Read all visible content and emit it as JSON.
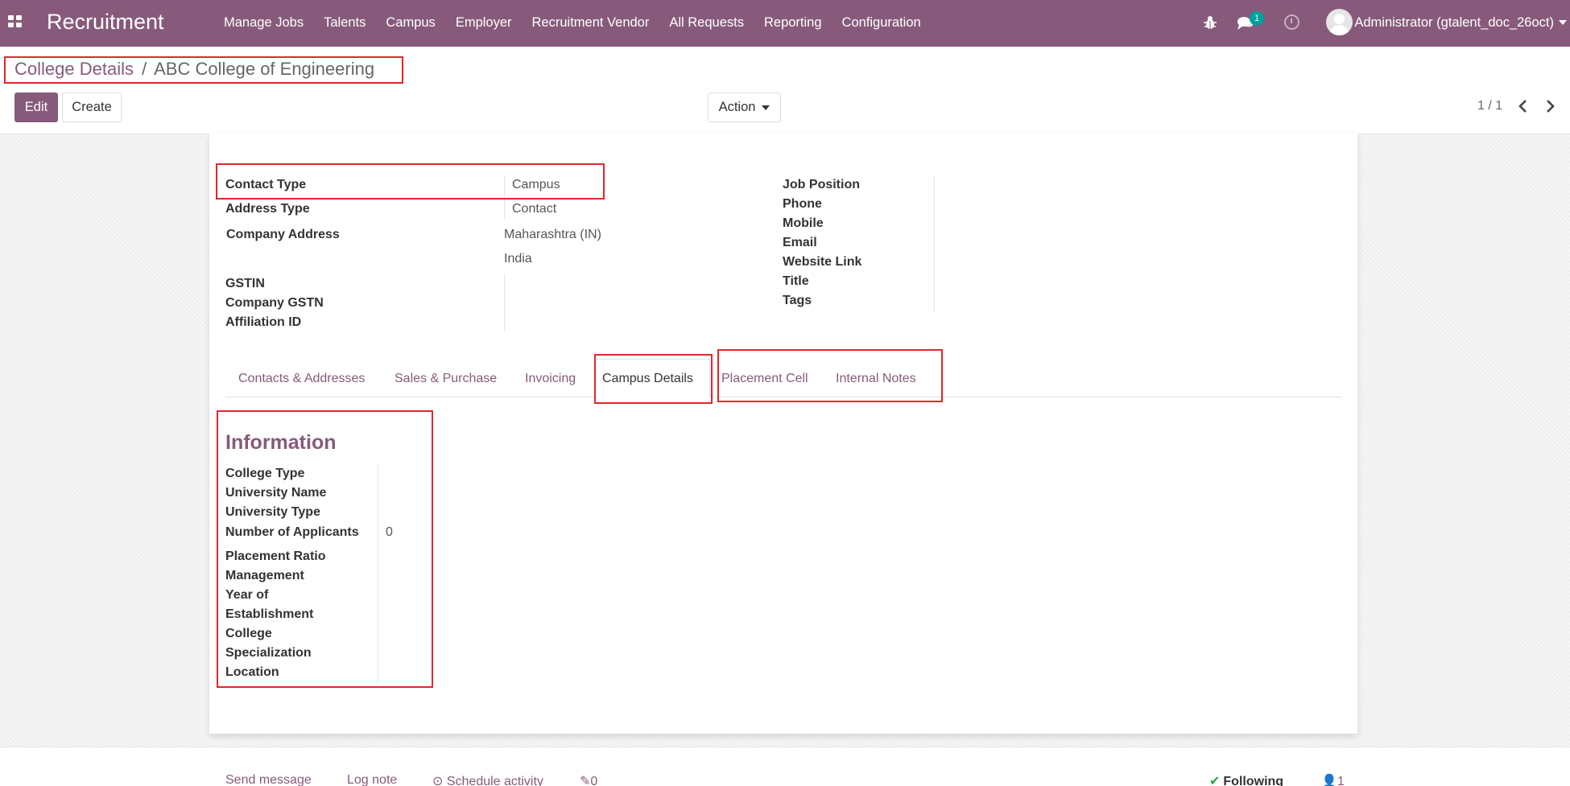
{
  "navbar": {
    "app_title": "Recruitment",
    "menu": [
      "Manage Jobs",
      "Talents",
      "Campus",
      "Employer",
      "Recruitment Vendor",
      "All Requests",
      "Reporting",
      "Configuration"
    ],
    "messages_badge": "1",
    "user": "Administrator (gtalent_doc_26oct)"
  },
  "breadcrumb": {
    "parent": "College Details",
    "separator": "/",
    "current": "ABC College of Engineering"
  },
  "buttons": {
    "edit": "Edit",
    "create": "Create",
    "action": "Action"
  },
  "pager": {
    "value": "1 / 1"
  },
  "form": {
    "left": {
      "contact_type_label": "Contact Type",
      "contact_type_value": "Campus",
      "address_type_label": "Address Type",
      "address_type_value": "Contact",
      "company_address_label": "Company Address",
      "address_state": "Maharashtra (IN)",
      "address_country": "India",
      "gstin_label": "GSTIN",
      "company_gstn_label": "Company GSTN",
      "affiliation_label": "Affiliation ID"
    },
    "right": [
      "Job Position",
      "Phone",
      "Mobile",
      "Email",
      "Website Link",
      "Title",
      "Tags"
    ]
  },
  "tabs": [
    "Contacts & Addresses",
    "Sales & Purchase",
    "Invoicing",
    "Campus Details",
    "Placement Cell",
    "Internal Notes"
  ],
  "active_tab": "Campus Details",
  "information": {
    "title": "Information",
    "labels": [
      "College Type",
      "University Name",
      "University Type",
      "Number of Applicants",
      "Placement Ratio",
      "Management",
      "Year of",
      "Establishment",
      "College",
      "Specialization",
      "Location"
    ],
    "applicants_value": "0"
  },
  "chatter": {
    "send_message": "Send message",
    "log_note": "Log note",
    "schedule_activity": "Schedule activity",
    "attachments": "0",
    "following": "Following",
    "followers": "1"
  },
  "colors": {
    "brand": "#875a7b",
    "highlight": "#e0272b",
    "badge": "#00a09d"
  }
}
